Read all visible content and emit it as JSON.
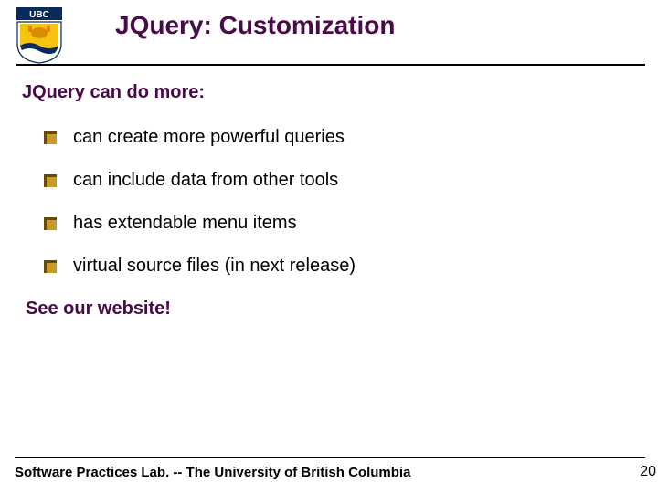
{
  "header": {
    "title": "JQuery: Customization",
    "logo_alt": "UBC crest"
  },
  "subheading": "JQuery can do more:",
  "bullets": [
    "can create more powerful queries",
    "can include data from other tools",
    "has extendable menu items",
    "virtual source files (in next release)"
  ],
  "see": "See our website!",
  "footer": {
    "text": "Software Practices Lab. -- The University of British Columbia",
    "page": "20"
  },
  "colors": {
    "accent": "#4a0a4a",
    "bullet_primary": "#6a4a00",
    "bullet_secondary": "#c89a2a"
  }
}
